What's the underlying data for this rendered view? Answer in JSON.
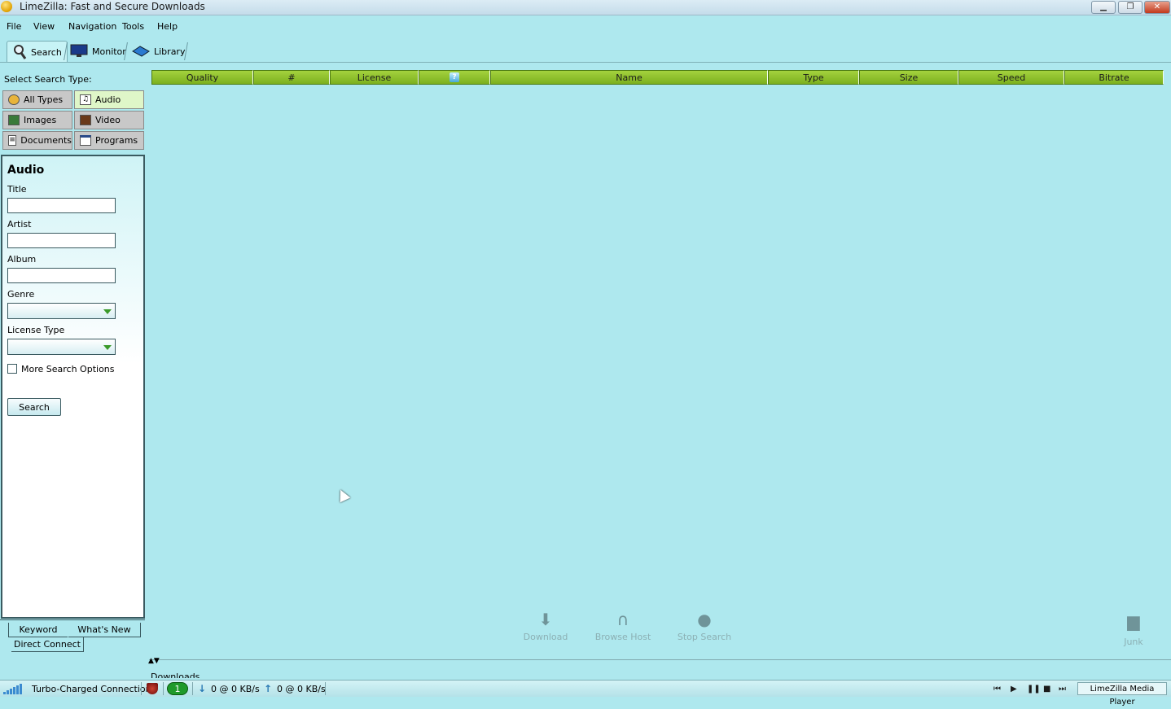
{
  "window": {
    "title": "LimeZilla: Fast and Secure Downloads",
    "minimize_icon": "minimize-icon",
    "restore_icon": "restore-icon",
    "close_icon": "close-icon"
  },
  "menu": {
    "items": [
      "File",
      "View",
      "Navigation",
      "Tools",
      "Help"
    ]
  },
  "toolbar": {
    "tabs": [
      {
        "label": "Search",
        "icon": "search-icon"
      },
      {
        "label": "Monitor",
        "icon": "monitor-icon"
      },
      {
        "label": "Library",
        "icon": "library-icon"
      }
    ],
    "selected": "Search"
  },
  "search_types": {
    "label": "Select Search Type:",
    "types": [
      {
        "label": "All Types",
        "icon": "all-types-icon"
      },
      {
        "label": "Audio",
        "icon": "audio-icon"
      },
      {
        "label": "Images",
        "icon": "images-icon"
      },
      {
        "label": "Video",
        "icon": "video-icon"
      },
      {
        "label": "Documents",
        "icon": "documents-icon"
      },
      {
        "label": "Programs",
        "icon": "programs-icon"
      }
    ],
    "selected": "Audio"
  },
  "form": {
    "title": "Audio",
    "fields": {
      "title_label": "Title",
      "title_value": "",
      "artist_label": "Artist",
      "artist_value": "",
      "album_label": "Album",
      "album_value": "",
      "genre_label": "Genre",
      "genre_value": "",
      "license_label": "License Type",
      "license_value": ""
    },
    "more_options_label": "More Search Options",
    "more_options_checked": false,
    "search_button": "Search"
  },
  "bottom_tabs": {
    "keyword": "Keyword",
    "whats_new": "What's New",
    "direct_connect": "Direct Connect",
    "selected": "Keyword"
  },
  "results": {
    "columns": [
      "Quality",
      "#",
      "License",
      "",
      "Name",
      "Type",
      "Size",
      "Speed",
      "Bitrate"
    ],
    "rows": []
  },
  "actions": {
    "download": "Download",
    "browse_host": "Browse Host",
    "stop_search": "Stop Search",
    "junk": "Junk"
  },
  "downloads": {
    "label": "Downloads"
  },
  "status": {
    "connection": "Turbo-Charged Connection",
    "peers": "1",
    "download_rate": "0 @ 0 KB/s",
    "upload_rate": "0 @ 0 KB/s",
    "media_player": "LimeZilla Media Player"
  },
  "colors": {
    "background": "#aee8ee",
    "header_green": "#8cc02c",
    "selected_type": "#dff6c8"
  }
}
